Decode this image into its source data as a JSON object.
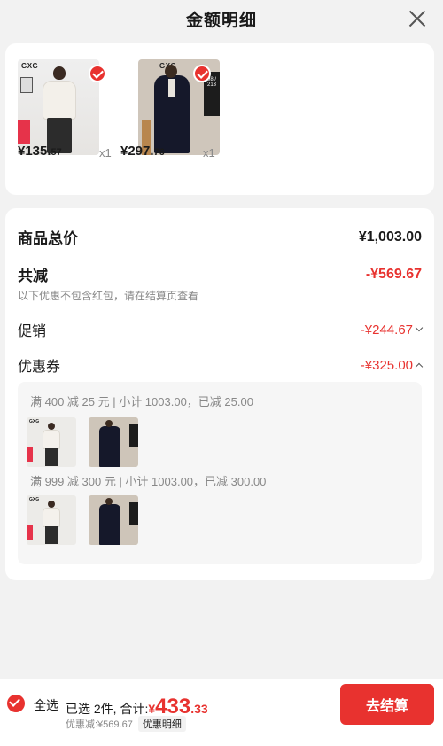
{
  "header": {
    "title": "金额明细"
  },
  "products": [
    {
      "brand": "GXG",
      "price_int": "¥135.",
      "price_dec": "57",
      "qty": "x1",
      "side_text": ""
    },
    {
      "brand": "GXG",
      "price_int": "¥297.",
      "price_dec": "76",
      "qty": "x1",
      "side_text": "98 / 213"
    }
  ],
  "summary": {
    "total_label": "商品总价",
    "total_value": "¥1,003.00",
    "reduce_label": "共减",
    "reduce_value": "-¥569.67",
    "reduce_note": "以下优惠不包含红包，请在结算页查看",
    "promo_label": "促销",
    "promo_value": "-¥244.67",
    "coupon_label": "优惠券",
    "coupon_value": "-¥325.00"
  },
  "coupons": [
    {
      "text": "满 400 减 25 元 | 小计 1003.00，已减 25.00"
    },
    {
      "text": "满 999 减 300 元 | 小计 1003.00，已减 300.00"
    }
  ],
  "footer": {
    "select_all": "全选",
    "selected_text": "已选 2件, 合计:",
    "currency": "¥",
    "total_int": "433",
    "total_dec": ".33",
    "discount_text": "优惠减:¥569.67",
    "detail_button": "优惠明细",
    "checkout_button": "去结算"
  },
  "colors": {
    "accent": "#e8322f",
    "muted": "#888888",
    "background": "#f2f2f2"
  }
}
